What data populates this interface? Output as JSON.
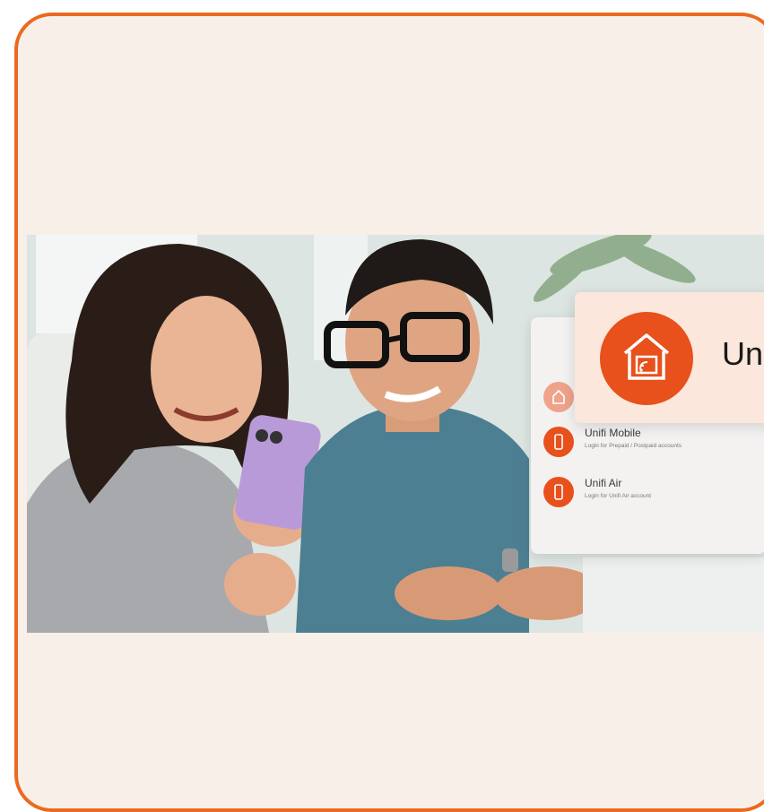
{
  "card": {
    "border_color": "#ea6a1f",
    "background": "#f8efe9"
  },
  "banner": {
    "photo": "two people looking at a smartphone",
    "header": {
      "brand_text": "Un",
      "logo_icon": "home-wifi-icon",
      "accent": "#e8501c"
    },
    "login_options": [
      {
        "icon": "home-icon",
        "title": "",
        "subtitle": ""
      },
      {
        "icon": "phone-icon",
        "title": "Unifi Mobile",
        "subtitle": "Login for Prepaid / Postpaid accounts"
      },
      {
        "icon": "phone-icon",
        "title": "Unifi Air",
        "subtitle": "Login for Unifi Air account"
      }
    ]
  }
}
